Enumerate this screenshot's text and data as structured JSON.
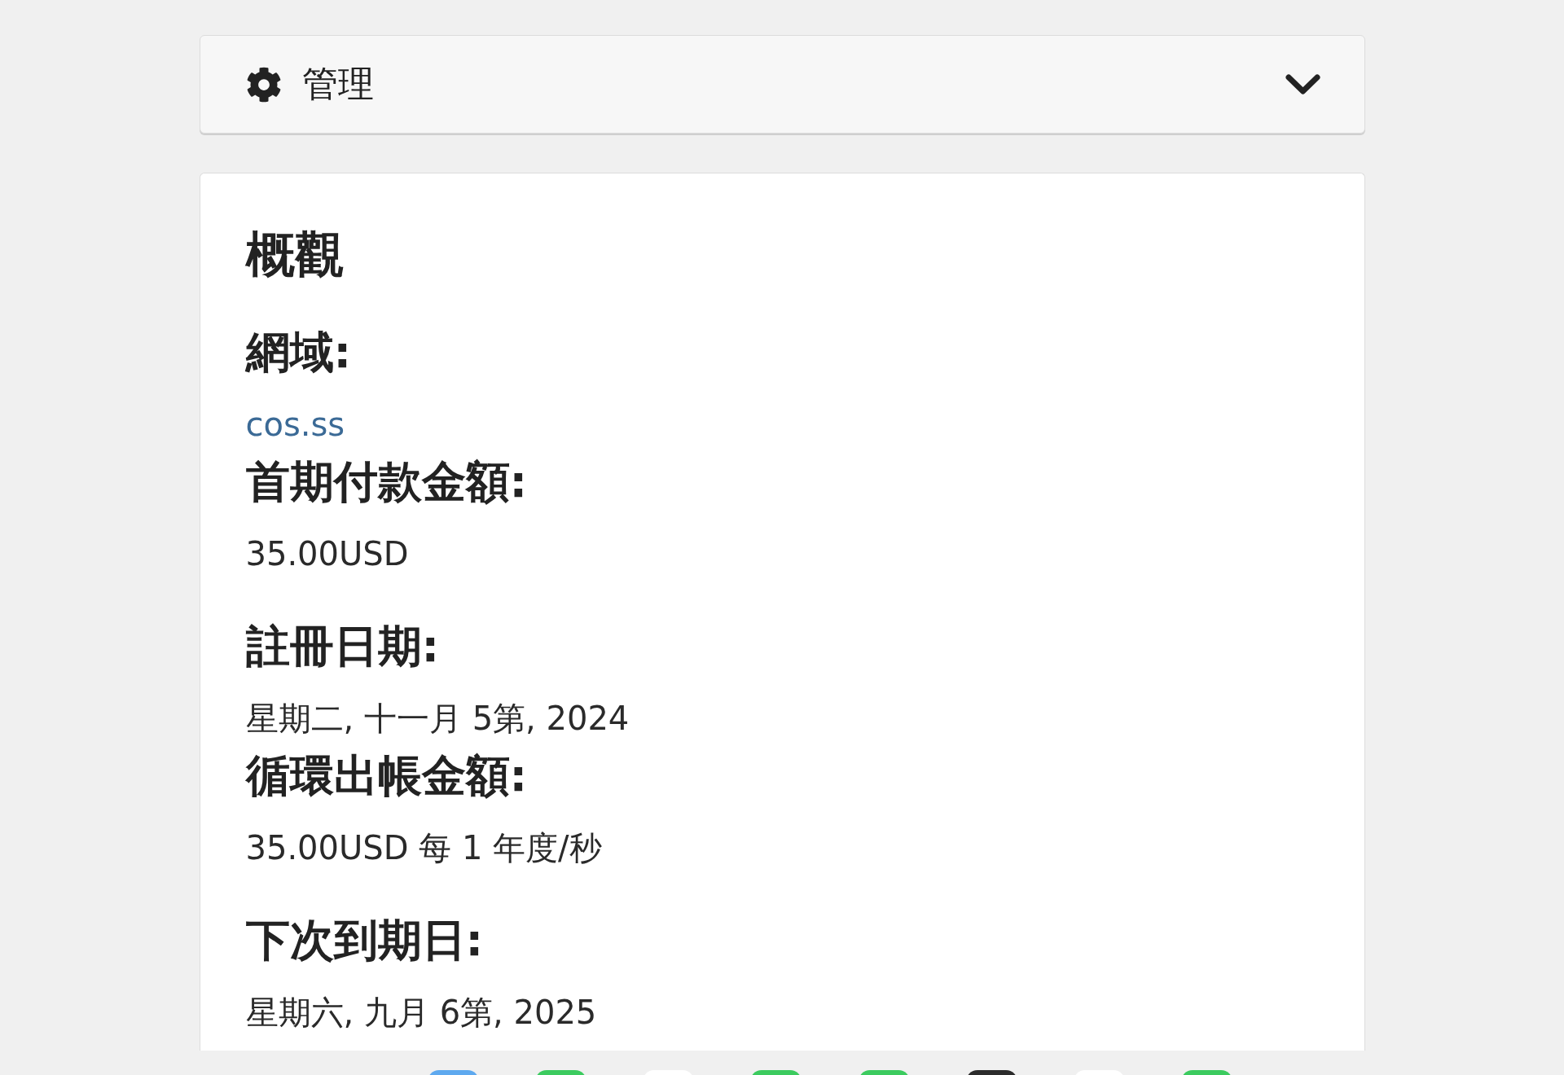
{
  "header": {
    "title": "管理",
    "expanded": false
  },
  "overview": {
    "title": "概觀",
    "fields": [
      {
        "label": "網域:",
        "value": "cos.ss",
        "kind": "link"
      },
      {
        "label": "首期付款金額:",
        "value": "35.00USD",
        "kind": "amount"
      },
      {
        "label": "註冊日期:",
        "value": "星期二, 十一月 5第, 2024",
        "kind": "date"
      },
      {
        "label": "循環出帳金額:",
        "value": "35.00USD 每 1 年度/秒",
        "kind": "amount"
      },
      {
        "label": "下次到期日:",
        "value": "星期六, 九月 6第, 2025",
        "kind": "date"
      }
    ]
  },
  "dock": [
    {
      "color": "#5ea9ef"
    },
    {
      "color": "#3ccb5f"
    },
    {
      "color": "#ffffff"
    },
    {
      "color": "#3ccb5f"
    },
    {
      "color": "#3ccb5f"
    },
    {
      "color": "#2c2c2c"
    },
    {
      "color": "#ffffff"
    },
    {
      "color": "#3ccb5f"
    }
  ]
}
